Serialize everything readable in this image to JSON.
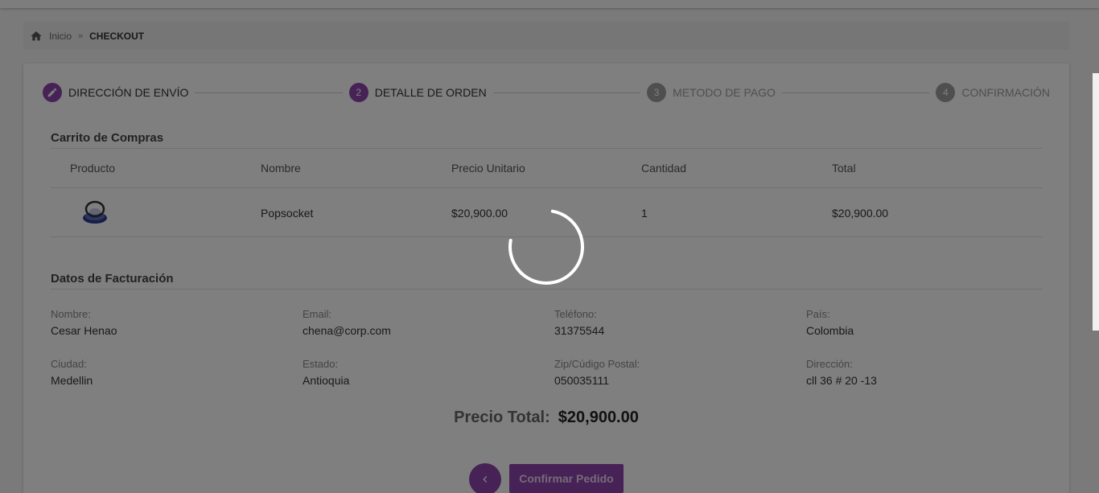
{
  "breadcrumb": {
    "home": "Inicio",
    "separator": "»",
    "current": "CHECKOUT"
  },
  "stepper": [
    {
      "number": "",
      "label": "DIRECCIÓN DE ENVÍO",
      "state": "done",
      "icon": "pencil-icon"
    },
    {
      "number": "2",
      "label": "DETALLE DE ORDEN",
      "state": "active"
    },
    {
      "number": "3",
      "label": "METODO DE PAGO",
      "state": "inactive"
    },
    {
      "number": "4",
      "label": "CONFIRMACIÓN",
      "state": "inactive"
    }
  ],
  "cart": {
    "title": "Carrito de Compras",
    "headers": [
      "Producto",
      "Nombre",
      "Precio Unitario",
      "Cantidad",
      "Total"
    ],
    "rows": [
      {
        "image": "popsocket-image",
        "name": "Popsocket",
        "unit_price": "$20,900.00",
        "quantity": "1",
        "total": "$20,900.00"
      }
    ]
  },
  "billing": {
    "title": "Datos de Facturación",
    "fields": [
      {
        "label": "Nombre:",
        "value": "Cesar Henao"
      },
      {
        "label": "Email:",
        "value": "chena@corp.com"
      },
      {
        "label": "Teléfono:",
        "value": "31375544"
      },
      {
        "label": "País:",
        "value": "Colombia"
      },
      {
        "label": "Ciudad:",
        "value": "Medellin"
      },
      {
        "label": "Estado:",
        "value": "Antioquia"
      },
      {
        "label": "Zip/Cúdigo Postal:",
        "value": "050035111"
      },
      {
        "label": "Dirección:",
        "value": "cll 36 # 20 -13"
      }
    ]
  },
  "summary": {
    "total_label": "Precio Total:",
    "total_value": "$20,900.00"
  },
  "actions": {
    "back_icon": "chevron-left-icon",
    "confirm_label": "Confirmar Pedido"
  },
  "loading": {
    "visible": true,
    "icon": "spinner-icon"
  },
  "colors": {
    "accent": "#8e44ad",
    "step_inactive": "#9e9e9e"
  }
}
